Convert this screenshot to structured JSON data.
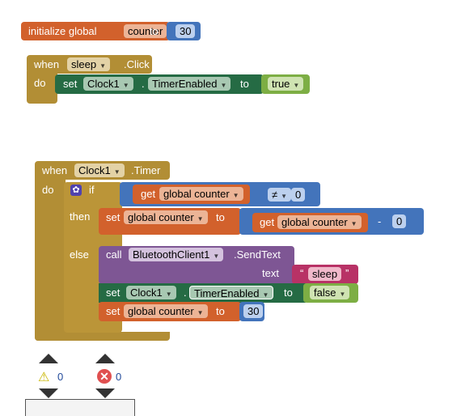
{
  "init": {
    "label": "initialize global",
    "var": "counter",
    "to": "to",
    "value": "30"
  },
  "click_event": {
    "when": "when",
    "component": "sleep",
    "event": ".Click",
    "do": "do",
    "set": {
      "set": "set",
      "component": "Clock1",
      "dot": ".",
      "property": "TimerEnabled",
      "to": "to",
      "value": "true"
    }
  },
  "timer_event": {
    "when": "when",
    "component": "Clock1",
    "event": ".Timer",
    "do": "do",
    "if": {
      "if": "if",
      "then": "then",
      "else": "else",
      "condition": {
        "get": "get",
        "var": "global counter",
        "op": "≠",
        "value": "0"
      },
      "then_set": {
        "set": "set",
        "var": "global counter",
        "to": "to",
        "get": "get",
        "get_var": "global counter",
        "op": "-",
        "value": "0"
      },
      "call": {
        "call": "call",
        "component": "BluetoothClient1",
        "method": ".SendText",
        "param": "text",
        "open_quote": "“",
        "value": "sleep",
        "close_quote": "”"
      },
      "set_timer": {
        "set": "set",
        "component": "Clock1",
        "dot": ".",
        "property": "TimerEnabled",
        "to": "to",
        "value": "false"
      },
      "reset": {
        "set": "set",
        "var": "global counter",
        "to": "to",
        "value": "30"
      }
    }
  },
  "indicators": {
    "warnings": "0",
    "errors": "0"
  },
  "colors": {
    "variables": "#d2612c",
    "math": "#4374bb",
    "control": "#b28e35",
    "component_setter": "#256b44",
    "logic": "#7dae44",
    "method": "#7e5694",
    "text": "#b83266"
  }
}
